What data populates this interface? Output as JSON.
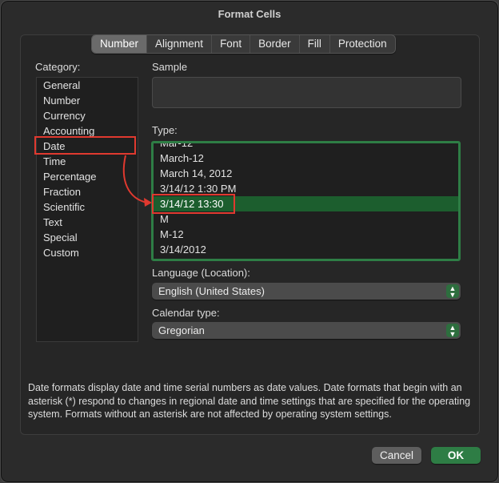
{
  "window": {
    "title": "Format Cells"
  },
  "tabs": [
    {
      "label": "Number",
      "active": true
    },
    {
      "label": "Alignment"
    },
    {
      "label": "Font"
    },
    {
      "label": "Border"
    },
    {
      "label": "Fill"
    },
    {
      "label": "Protection"
    }
  ],
  "category": {
    "label": "Category:",
    "items": [
      "General",
      "Number",
      "Currency",
      "Accounting",
      "Date",
      "Time",
      "Percentage",
      "Fraction",
      "Scientific",
      "Text",
      "Special",
      "Custom"
    ],
    "selected": "Date"
  },
  "sample": {
    "label": "Sample",
    "value": ""
  },
  "type": {
    "label": "Type:",
    "items": [
      "Mar-12",
      "March-12",
      "March 14, 2012",
      "3/14/12 1:30 PM",
      "3/14/12 13:30",
      "M",
      "M-12",
      "3/14/2012"
    ],
    "selected": "3/14/12 13:30"
  },
  "language": {
    "label": "Language (Location):",
    "value": "English (United States)"
  },
  "calendar": {
    "label": "Calendar type:",
    "value": "Gregorian"
  },
  "description": "Date formats display date and time serial numbers as date values.  Date formats that begin with an asterisk (*) respond to changes in regional date and time settings that are specified for the operating system. Formats without an asterisk are not affected by operating system settings.",
  "buttons": {
    "cancel": "Cancel",
    "ok": "OK"
  },
  "colors": {
    "accent": "#2e7d45",
    "selection": "#1c5e2e",
    "annotation": "#e0392f"
  },
  "icons": {
    "select_arrows": "chevron-up-down-icon"
  }
}
